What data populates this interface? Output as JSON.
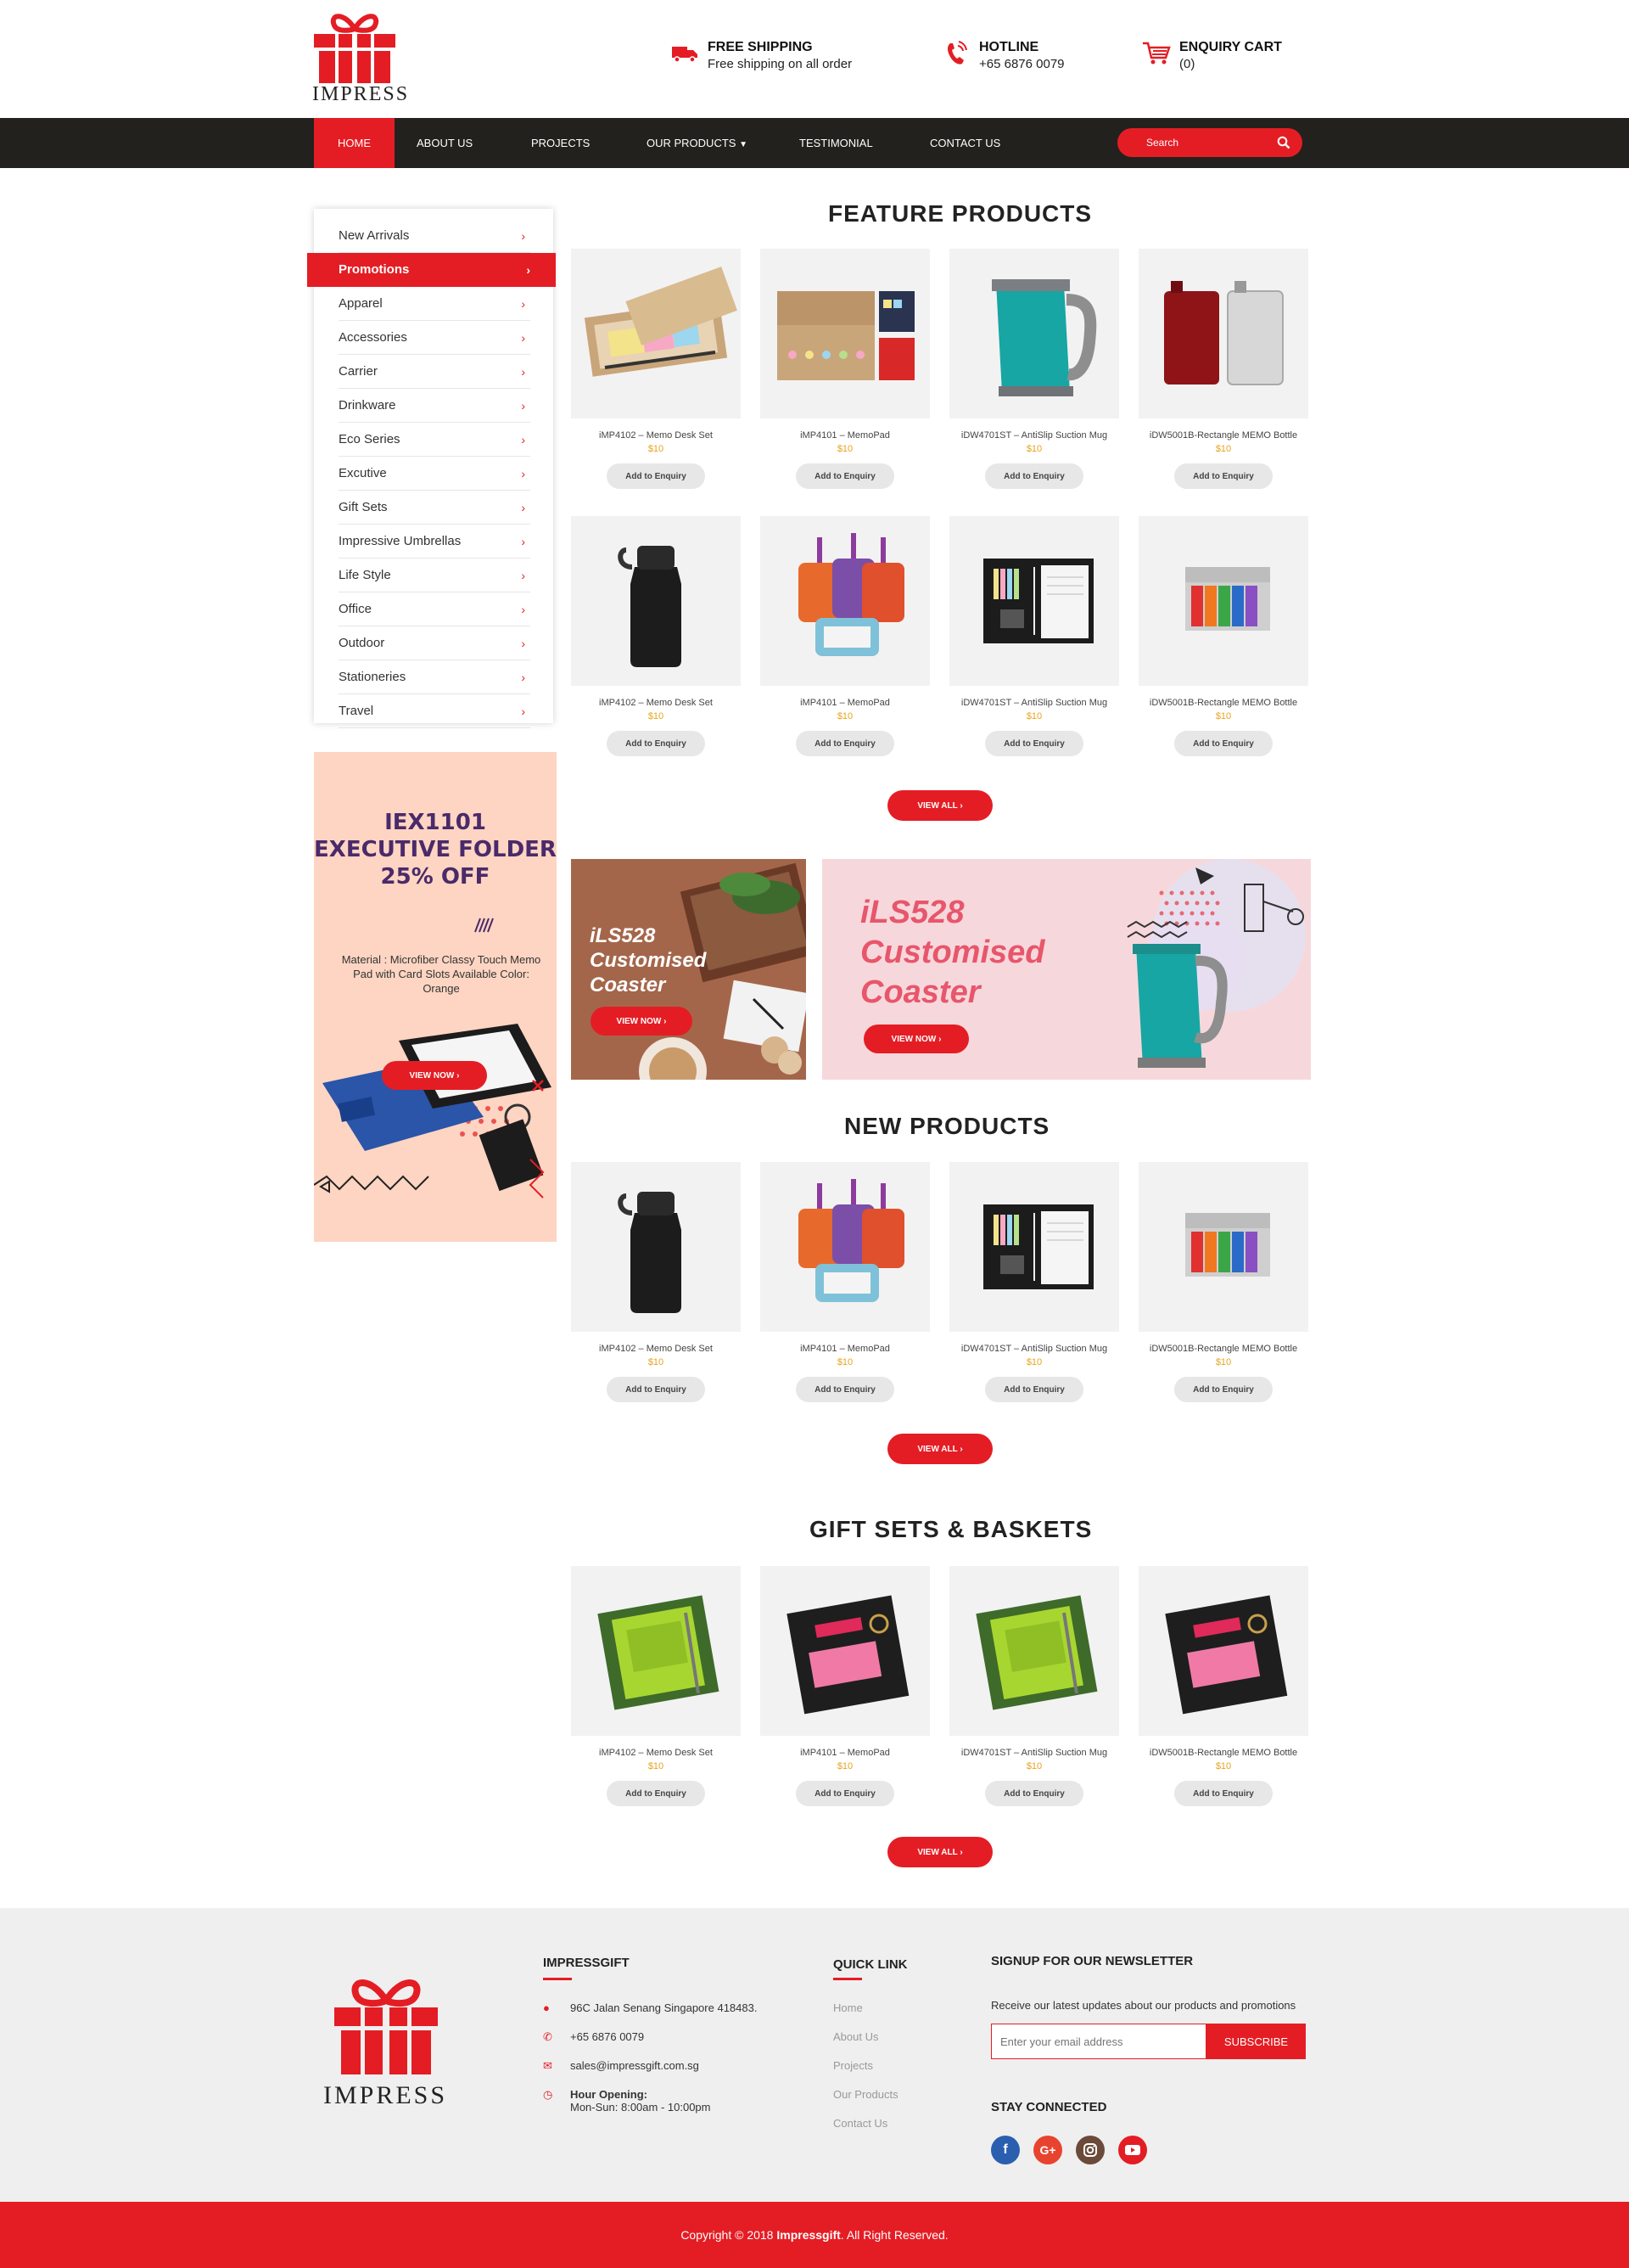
{
  "brand": {
    "name": "IMPRESS",
    "primary": "#e41d24",
    "dark": "#23211d"
  },
  "header": {
    "shipping": {
      "title": "FREE SHIPPING",
      "sub": "Free shipping on all order",
      "icon": "truck-icon"
    },
    "hotline": {
      "title": "HOTLINE",
      "sub": "+65 6876 0079",
      "icon": "phone-icon"
    },
    "cart": {
      "title": "ENQUIRY CART",
      "sub": "(0)",
      "icon": "cart-icon"
    }
  },
  "nav": {
    "items": [
      "HOME",
      "ABOUT US",
      "PROJECTS",
      "OUR PRODUCTS",
      "TESTIMONIAL",
      "CONTACT US"
    ],
    "active": "HOME",
    "search_placeholder": "Search"
  },
  "sidebar": {
    "items": [
      "New Arrivals",
      "Promotions",
      "Apparel",
      "Accessories",
      "Carrier",
      "Drinkware",
      "Eco Series",
      "Excutive",
      "Gift Sets",
      "Impressive Umbrellas",
      "Life Style",
      "Office",
      "Outdoor",
      "Stationeries",
      "Travel"
    ],
    "active": "Promotions"
  },
  "promo": {
    "line1": "IEX1101",
    "line2": "EXECUTIVE FOLDER",
    "line3": "25% OFF",
    "desc": "Material : Microfiber Classy Touch Memo Pad with Card Slots Available Color: Orange",
    "button": "VIEW NOW ›"
  },
  "featured": {
    "title": "FEATURE PRODUCTS",
    "products": [
      {
        "name": "iMP4102 – Memo Desk Set",
        "price": "$10",
        "button": "Add to Enquiry",
        "image": "memo-desk-set"
      },
      {
        "name": "iMP4101 – MemoPad",
        "price": "$10",
        "button": "Add to Enquiry",
        "image": "memopad"
      },
      {
        "name": "iDW4701ST – AntiSlip Suction Mug",
        "price": "$10",
        "button": "Add to Enquiry",
        "image": "teal-mug"
      },
      {
        "name": "iDW5001B-Rectangle MEMO Bottle",
        "price": "$10",
        "button": "Add to Enquiry",
        "image": "rect-bottle"
      },
      {
        "name": "iMP4102 – Memo Desk Set",
        "price": "$10",
        "button": "Add to Enquiry",
        "image": "black-bottle"
      },
      {
        "name": "iMP4101 – MemoPad",
        "price": "$10",
        "button": "Add to Enquiry",
        "image": "luggage-tags"
      },
      {
        "name": "iDW4701ST – AntiSlip Suction Mug",
        "price": "$10",
        "button": "Add to Enquiry",
        "image": "folder"
      },
      {
        "name": "iDW5001B-Rectangle MEMO Bottle",
        "price": "$10",
        "button": "Add to Enquiry",
        "image": "sticky-flags"
      }
    ],
    "view_all": "VIEW ALL ›"
  },
  "banners": {
    "small": {
      "title": "iLS528 Customised Coaster",
      "button": "VIEW NOW ›"
    },
    "large": {
      "title": "iLS528 Customised Coaster",
      "button": "VIEW NOW ›"
    }
  },
  "new_products": {
    "title": "NEW PRODUCTS",
    "products": [
      {
        "name": "iMP4102 – Memo Desk Set",
        "price": "$10",
        "button": "Add to Enquiry",
        "image": "black-bottle"
      },
      {
        "name": "iMP4101 – MemoPad",
        "price": "$10",
        "button": "Add to Enquiry",
        "image": "luggage-tags"
      },
      {
        "name": "iDW4701ST – AntiSlip Suction Mug",
        "price": "$10",
        "button": "Add to Enquiry",
        "image": "folder"
      },
      {
        "name": "iDW5001B-Rectangle MEMO Bottle",
        "price": "$10",
        "button": "Add to Enquiry",
        "image": "sticky-flags"
      }
    ],
    "view_all": "VIEW ALL ›"
  },
  "gift_sets": {
    "title": "GIFT SETS & BASKETS",
    "products": [
      {
        "name": "iMP4102 – Memo Desk Set",
        "price": "$10",
        "button": "Add to Enquiry",
        "image": "green-notebook-set"
      },
      {
        "name": "iMP4101 – MemoPad",
        "price": "$10",
        "button": "Add to Enquiry",
        "image": "black-gift-set"
      },
      {
        "name": "iDW4701ST – AntiSlip Suction Mug",
        "price": "$10",
        "button": "Add to Enquiry",
        "image": "green-notebook-set"
      },
      {
        "name": "iDW5001B-Rectangle MEMO Bottle",
        "price": "$10",
        "button": "Add to Enquiry",
        "image": "black-gift-set"
      }
    ],
    "view_all": "VIEW ALL ›"
  },
  "footer": {
    "company": {
      "title": "IMPRESSGIFT",
      "address": "96C Jalan Senang Singapore 418483.",
      "phone": "+65 6876 0079",
      "email": "sales@impressgift.com.sg",
      "hours_label": "Hour Opening:",
      "hours": "Mon-Sun: 8:00am - 10:00pm"
    },
    "quick_link": {
      "title": "QUICK LINK",
      "links": [
        "Home",
        "About Us",
        "Projects",
        "Our Products",
        "Contact Us"
      ]
    },
    "newsletter": {
      "title": "SIGNUP FOR OUR NEWSLETTER",
      "desc": "Receive our latest updates about our products and promotions",
      "placeholder": "Enter your email address",
      "button": "SUBSCRIBE"
    },
    "social": {
      "title": "STAY CONNECTED",
      "items": [
        "facebook-icon",
        "google-plus-icon",
        "instagram-icon",
        "youtube-icon"
      ]
    },
    "copyright_prefix": "Copyright © 2018 ",
    "copyright_brand": "Impressgift",
    "copyright_suffix": ". All Right Reserved."
  }
}
